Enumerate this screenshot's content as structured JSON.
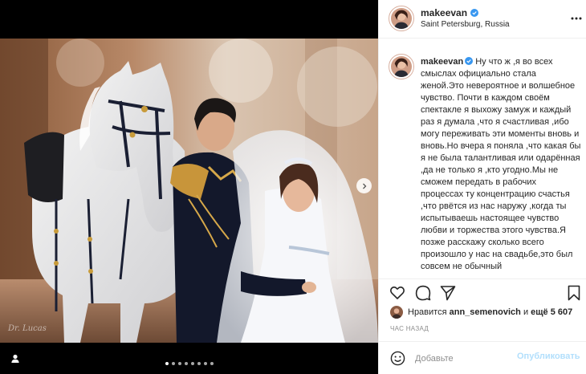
{
  "post": {
    "username": "makeevan",
    "location": "Saint Petersburg, Russia",
    "caption_username": "makeevan",
    "caption_text": "Ну что ж ,я во всех смыслах официально стала женой.Это невероятное и волшебное чувство. Почти в каждом своём спектакле я выхожу замуж и каждый раз я думала ,что я счастливая ,ибо могу переживать эти моменты вновь и вновь.Но вчера я поняла ,что какая бы я не была талантливая или одарённая ,да не только я ,кто угодно.Мы не сможем передать в рабочих процессах ту концентрацию счастья ,что рвётся из нас наружу ,когда ты испытываешь настоящее чувство любви и торжества этого чувства.Я позже расскажу сколько всего произошло у нас на свадьбе,это был совсем не обычный",
    "likes_prefix": "Нравится",
    "likes_user": "ann_semenovich",
    "likes_mid": "и",
    "likes_count": "ещё 5 607",
    "time_ago": "ЧАС НАЗАД",
    "watermark": "Dr. Lucas"
  },
  "carousel": {
    "total": 8,
    "active": 1
  },
  "icons": {
    "verified": "verified-badge-icon",
    "more": "more-options-icon",
    "next": "chevron-right-icon",
    "tag": "user-tag-icon",
    "like": "heart-icon",
    "comment": "comment-icon",
    "share": "paper-plane-icon",
    "save": "bookmark-icon",
    "emoji": "smiley-icon"
  },
  "comment_box": {
    "placeholder": "Добавьте",
    "publish_label": "Опубликовать"
  },
  "colors": {
    "verified": "#3897f0",
    "publish_disabled": "#b2dffc",
    "secondary_text": "#8e8e8e",
    "divider": "#efefef"
  }
}
